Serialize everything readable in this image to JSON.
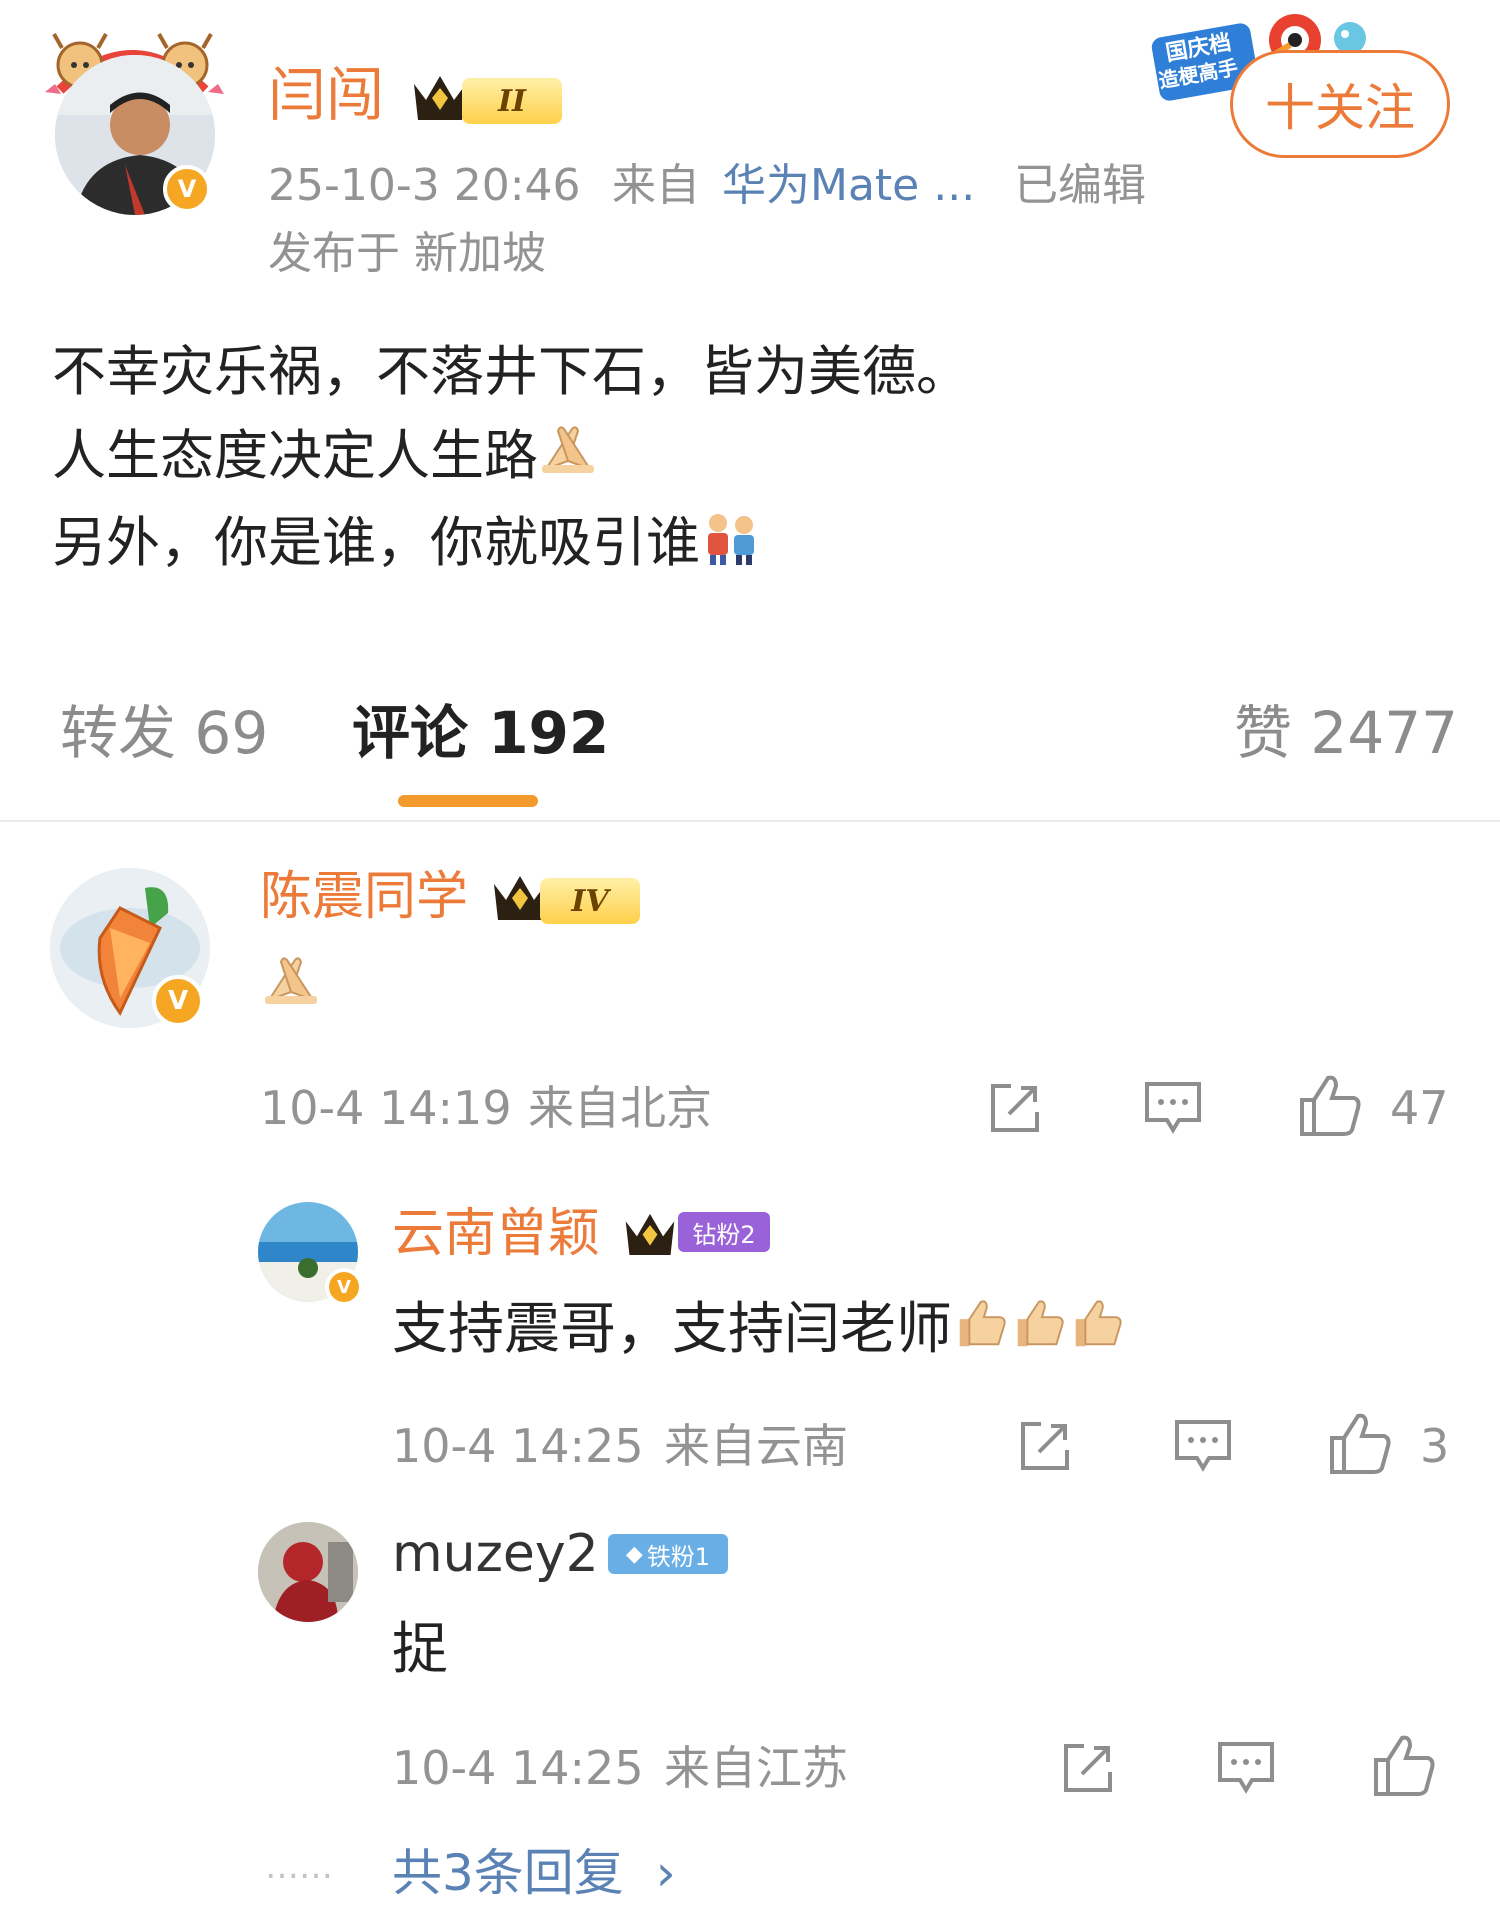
{
  "post": {
    "author": "闫闯",
    "crown_level": "II",
    "time": "25-10-3 20:46",
    "from_label": "来自",
    "device": "华为Mate ...",
    "edited": "已编辑",
    "location_line": "发布于 新加坡",
    "lines": [
      "不幸灾乐祸，不落井下石，皆为美德。",
      "人生态度决定人生路",
      "另外，你是谁，你就吸引谁"
    ],
    "follow_button": "十关注",
    "festival_badge_line1": "国庆档",
    "festival_badge_line2": "造梗高手"
  },
  "tabs": {
    "repost": "转发 69",
    "comments": "评论 192",
    "likes": "赞 2477"
  },
  "comments": [
    {
      "name": "陈震同学",
      "crown_level": "IV",
      "text": "",
      "time": "10-4 14:19",
      "location": "来自北京",
      "likes": "47"
    }
  ],
  "replies": [
    {
      "name": "云南曾颖",
      "fan_badge": "钻粉2",
      "text": "支持震哥，支持闫老师",
      "time": "10-4 14:25",
      "location": "来自云南",
      "likes": "3"
    },
    {
      "name": "muzey2",
      "fan_badge": "铁粉1",
      "text": "捉",
      "time": "10-4 14:25",
      "location": "来自江苏",
      "likes": ""
    }
  ],
  "more_replies": "共3条回复",
  "more_dots": "……",
  "icons": [
    "repost-icon",
    "comment-icon",
    "like-icon",
    "verified-icon",
    "crown-icon",
    "chevron-right-icon"
  ],
  "colors": {
    "accent": "#ec7b3a",
    "verified": "#f5a623",
    "link": "#5a82b4",
    "tab_underline": "#f39a2d"
  }
}
